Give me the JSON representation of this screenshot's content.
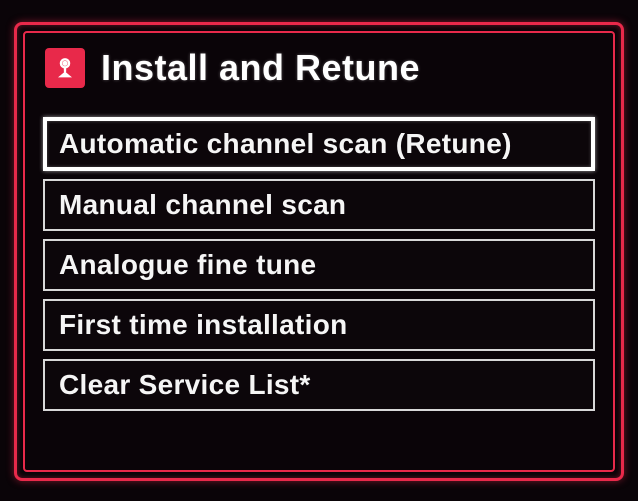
{
  "header": {
    "title": "Install and Retune",
    "icon": "satellite-dish-icon"
  },
  "menu": {
    "items": [
      {
        "label": "Automatic channel scan (Retune)",
        "selected": true
      },
      {
        "label": "Manual channel scan",
        "selected": false
      },
      {
        "label": "Analogue fine tune",
        "selected": false
      },
      {
        "label": "First time installation",
        "selected": false
      },
      {
        "label": "Clear Service List*",
        "selected": false
      }
    ]
  },
  "colors": {
    "accent": "#e8294a",
    "text": "#ffffff",
    "border": "#d8d8d8",
    "background": "#0a0408"
  }
}
